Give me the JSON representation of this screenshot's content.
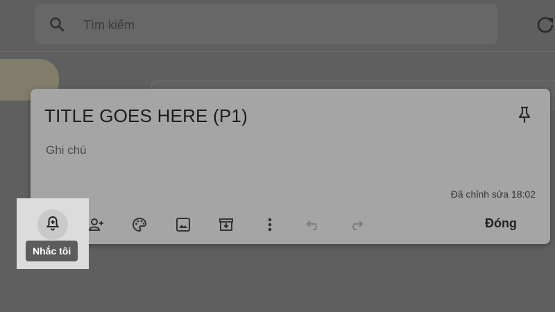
{
  "search": {
    "placeholder": "Tìm kiếm",
    "icon": "search-icon"
  },
  "header": {
    "refresh_icon": "refresh-icon"
  },
  "note": {
    "title": "TITLE GOES HERE (P1)",
    "body": "Ghi chú",
    "edited": "Đã chỉnh sửa 18:02",
    "pin_icon": "pin-icon"
  },
  "toolbar": {
    "close_label": "Đóng",
    "tools": [
      "remind-me-icon",
      "collaborator-icon",
      "palette-icon",
      "image-icon",
      "archive-icon",
      "more-vert-icon",
      "undo-icon",
      "redo-icon"
    ]
  },
  "tooltip": {
    "text": "Nhắc tôi"
  },
  "colors": {
    "overlay": "#5f5f5f",
    "note_bg": "#a5a5a5",
    "tooltip_bg": "#5c5c5c"
  }
}
